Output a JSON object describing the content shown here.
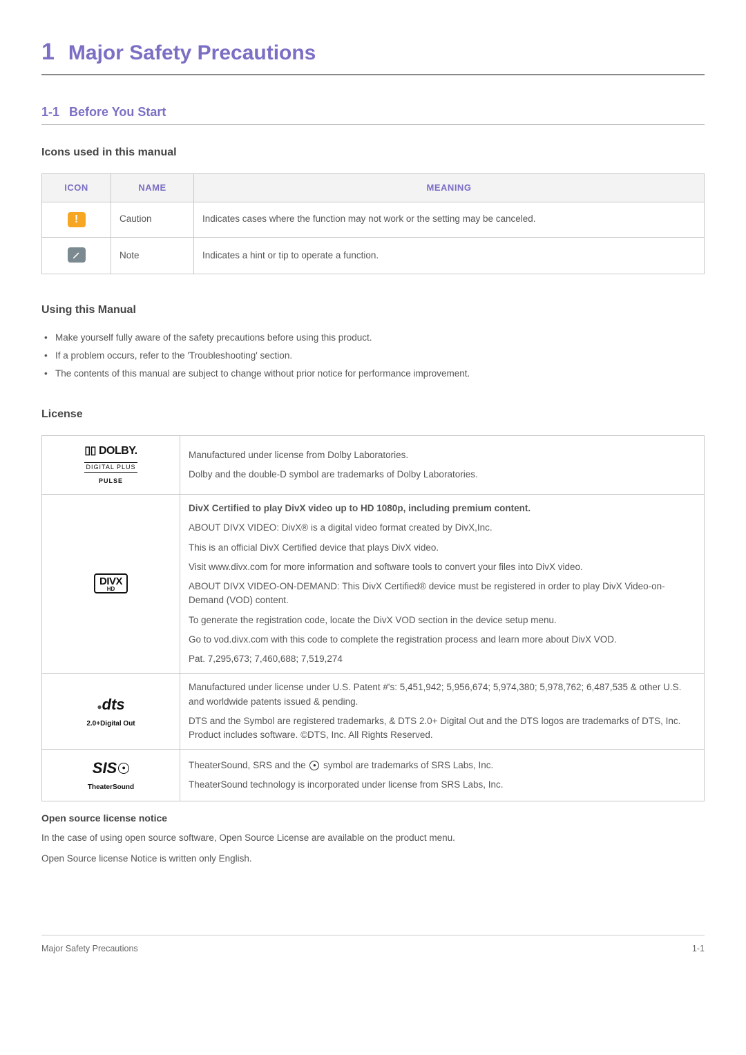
{
  "chapter": {
    "num": "1",
    "title": "Major Safety Precautions"
  },
  "section": {
    "num": "1-1",
    "title": "Before You Start"
  },
  "icons_section": {
    "heading": "Icons used in this manual",
    "headers": {
      "icon": "ICON",
      "name": "NAME",
      "meaning": "MEANING"
    },
    "rows": [
      {
        "icon_name": "caution-icon",
        "name": "Caution",
        "meaning": "Indicates cases where the function may not work or the setting may be canceled."
      },
      {
        "icon_name": "note-icon",
        "name": "Note",
        "meaning": "Indicates a hint or tip to operate a function."
      }
    ]
  },
  "using_manual": {
    "heading": "Using this Manual",
    "items": [
      "Make yourself fully aware of the safety precautions before using this product.",
      "If a problem occurs, refer to the 'Troubleshooting' section.",
      "The contents of this manual are subject to change without prior notice for performance improvement."
    ]
  },
  "license": {
    "heading": "License",
    "rows": [
      {
        "logo": "dolby",
        "paras": [
          "Manufactured under license from Dolby Laboratories.",
          "Dolby and the double-D symbol are trademarks of Dolby Laboratories."
        ]
      },
      {
        "logo": "divx",
        "bold_first": true,
        "paras": [
          "DivX Certified to play DivX video up to HD 1080p, including premium content.",
          "ABOUT DIVX VIDEO: DivX® is a digital video format created by DivX,Inc.",
          "This is an official DivX Certified device that plays DivX video.",
          "Visit www.divx.com for more information and software tools to convert your files into DivX video.",
          "ABOUT DIVX VIDEO-ON-DEMAND: This DivX Certified® device must be registered in order to play DivX Video-on-Demand (VOD) content.",
          "To generate the registration code, locate the DivX VOD section in the device setup menu.",
          "Go to vod.divx.com with this code to complete the registration process and learn more about DivX VOD.",
          "Pat. 7,295,673; 7,460,688; 7,519,274"
        ]
      },
      {
        "logo": "dts",
        "paras": [
          "Manufactured under license under U.S. Patent #'s: 5,451,942; 5,956,674; 5,974,380; 5,978,762; 6,487,535 & other U.S. and worldwide patents issued & pending.",
          "DTS and the Symbol are registered trademarks, & DTS 2.0+ Digital Out and the DTS logos are trademarks of DTS, Inc. Product includes software. ©DTS, Inc. All Rights Reserved."
        ]
      },
      {
        "logo": "srs",
        "paras_before_symbol": "TheaterSound, SRS and the ",
        "paras_after_symbol": " symbol are trademarks of SRS Labs, Inc.",
        "para2": "TheaterSound technology is incorporated under license from SRS Labs, Inc."
      }
    ],
    "open_source": {
      "heading": "Open source license notice",
      "p1": "In the case of using open source software, Open Source License are available on the product menu.",
      "p2": "Open Source license Notice is written only English."
    }
  },
  "footer": {
    "left": "Major Safety Precautions",
    "right": "1-1"
  },
  "logo_text": {
    "dolby_main": "DOLBY.",
    "dolby_sub": "DIGITAL PLUS",
    "dolby_pulse": "PULSE",
    "divx_main": "DIVX",
    "divx_sub": "HD",
    "dts_main": "dts",
    "dts_sub": "2.0+Digital Out",
    "srs_main": "SIS",
    "srs_sub": "TheaterSound"
  }
}
